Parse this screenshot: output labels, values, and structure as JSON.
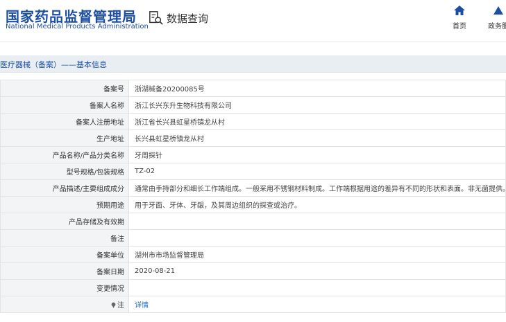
{
  "header": {
    "logo_cn": "国家药品监督管理局",
    "logo_en": "National Medical Products Administration",
    "query_label": "数据查询",
    "nav": [
      {
        "label": "首页",
        "icon": "home-icon"
      },
      {
        "label": "政务服",
        "icon": "triangle-icon"
      }
    ]
  },
  "section": {
    "title": "医疗器械（备案）——基本信息"
  },
  "rows": [
    {
      "key": "备案号",
      "value": "浙湖械备20200085号"
    },
    {
      "key": "备案人名称",
      "value": "浙江长兴东升生物科技有限公司"
    },
    {
      "key": "备案人注册地址",
      "value": "浙江省长兴县虹星桥镇龙从村"
    },
    {
      "key": "生产地址",
      "value": "长兴县虹星桥镇龙从村"
    },
    {
      "key": "产品名称/产品分类名称",
      "value": "牙周探针"
    },
    {
      "key": "型号规格/包装规格",
      "value": "TZ-02"
    },
    {
      "key": "产品描述/主要组成成分",
      "value": "通常由手持部分和细长工作端组成。一般采用不锈钢材料制成。工作端根据用途的差异有不同的形状和表面。非无菌提供。"
    },
    {
      "key": "预期用途",
      "value": "用于牙面、牙体、牙龈，及其周边组织的探查或治疗。"
    },
    {
      "key": "产品存储及有效期",
      "value": ""
    },
    {
      "key": "备注",
      "value": ""
    },
    {
      "key": "备案单位",
      "value": "湖州市市场监督管理局"
    },
    {
      "key": "备案日期",
      "value": "2020-08-21"
    },
    {
      "key": "变更情况",
      "value": ""
    },
    {
      "key": "注",
      "value": "详情",
      "icon": "pin-icon"
    }
  ],
  "colors": {
    "brand_blue": "#1c4fa1",
    "link_blue": "#1c6ac8",
    "section_bg": "#e9eef3",
    "key_bg": "#f3f4f6"
  }
}
